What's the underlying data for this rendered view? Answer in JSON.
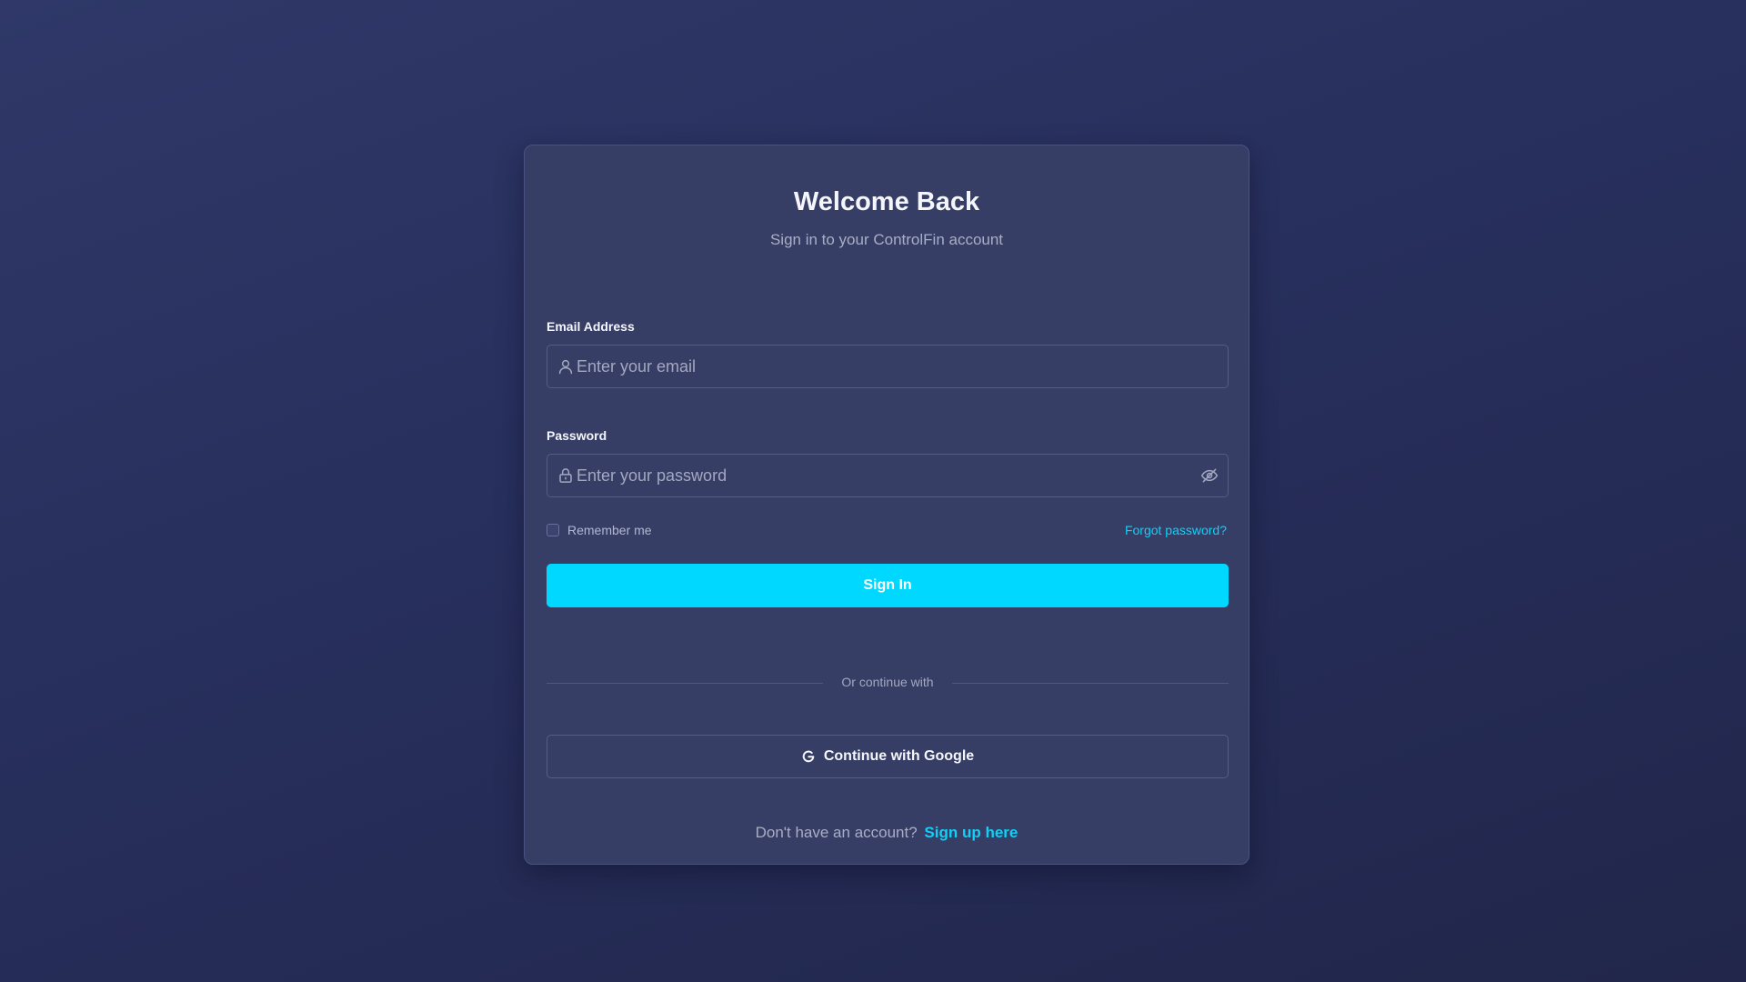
{
  "header": {
    "title": "Welcome Back",
    "subtitle": "Sign in to your ControlFin account"
  },
  "email": {
    "label": "Email Address",
    "placeholder": "Enter your email",
    "value": "",
    "icon": "user-icon"
  },
  "password": {
    "label": "Password",
    "placeholder": "Enter your password",
    "value": "",
    "icon": "lock-icon",
    "toggle_icon": "eye-off-icon"
  },
  "options": {
    "remember_label": "Remember me",
    "remember_checked": false,
    "forgot_label": "Forgot password?"
  },
  "actions": {
    "signin_label": "Sign In",
    "divider_text": "Or continue with",
    "google_label": "Continue with Google",
    "google_icon": "google-icon"
  },
  "footer": {
    "prompt": "Don't have an account?",
    "signup_label": "Sign up here"
  },
  "colors": {
    "accent": "#00d8ff",
    "link": "#10d0f5",
    "card_background": "#363e66",
    "page_background": "#272f5c"
  }
}
